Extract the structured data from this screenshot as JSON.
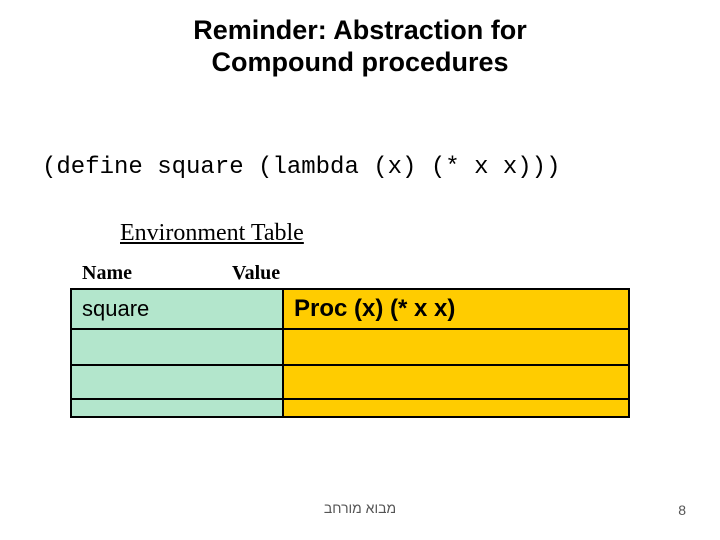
{
  "title": "Reminder: Abstraction for\nCompound procedures",
  "code": "(define square (lambda (x) (* x x)))",
  "env_table_title": "Environment Table",
  "columns": {
    "name": "Name",
    "value": "Value"
  },
  "rows": [
    {
      "name": "square",
      "value": "Proc (x) (* x x)"
    },
    {
      "name": "",
      "value": ""
    },
    {
      "name": "",
      "value": ""
    },
    {
      "name": "",
      "value": ""
    }
  ],
  "footer": "מבוא מורחב",
  "page_number": "8"
}
